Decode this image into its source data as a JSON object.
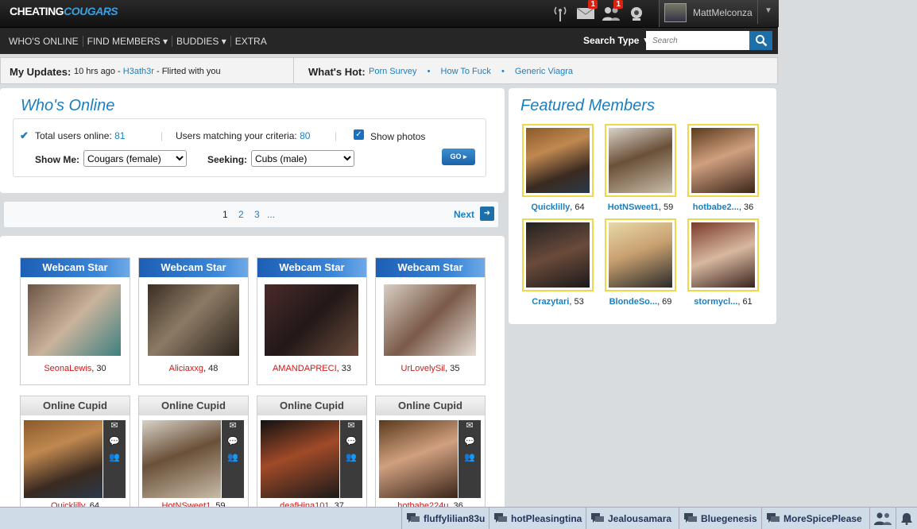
{
  "header": {
    "logo_part1": "CHEATING",
    "logo_part2": "COUGARS",
    "mail_badge": "1",
    "buddies_badge": "1",
    "username": "MattMelconza"
  },
  "nav": {
    "items": [
      "WHO'S ONLINE",
      "FIND MEMBERS ▾",
      "BUDDIES ▾",
      "EXTRA"
    ],
    "search_type": "Search Type ▼",
    "search_placeholder": "Search"
  },
  "updates": {
    "label": "My Updates:",
    "time": "10 hrs ago -",
    "user": "H3ath3r",
    "action": "- Flirted with you",
    "hot_label": "What's Hot:",
    "hot_links": [
      "Porn Survey",
      "How To Fuck",
      "Generic Viagra"
    ]
  },
  "whos_online": {
    "title": "Who's Online",
    "total_label": "Total users online:",
    "total_value": "81",
    "matching_label": "Users matching your criteria:",
    "matching_value": "80",
    "show_photos": "Show photos",
    "show_me_label": "Show Me:",
    "show_me_value": "Cougars (female)",
    "seeking_label": "Seeking:",
    "seeking_value": "Cubs (male)",
    "go": "GO ▸"
  },
  "pager": {
    "pages": [
      "1",
      "2",
      "3",
      "..."
    ],
    "next": "Next"
  },
  "webcam_header": "Webcam Star",
  "cupid_header": "Online Cupid",
  "webcam_cards": [
    {
      "name": "SeonaLewis",
      "age": ", 30"
    },
    {
      "name": "Aliciaxxg",
      "age": ", 48"
    },
    {
      "name": "AMANDAPRECI",
      "age": ", 33"
    },
    {
      "name": "UrLovelySil",
      "age": ", 35"
    }
  ],
  "cupid_cards": [
    {
      "name": "Quicklilly",
      "age": ", 64"
    },
    {
      "name": "HotNSweet1",
      "age": ", 59"
    },
    {
      "name": "deafHina101",
      "age": ", 37"
    },
    {
      "name": "hotbabe224u",
      "age": ", 36"
    }
  ],
  "featured": {
    "title": "Featured Members",
    "members": [
      {
        "name": "Quicklilly",
        "age": ", 64"
      },
      {
        "name": "HotNSweet1",
        "age": ", 59"
      },
      {
        "name": "hotbabe2...",
        "age": ", 36"
      },
      {
        "name": "Crazytari",
        "age": ", 53"
      },
      {
        "name": "BlondeSo...",
        "age": ", 69"
      },
      {
        "name": "stormycl...",
        "age": ", 61"
      }
    ]
  },
  "chatbar": [
    "fluffylilian83u",
    "hotPleasingtina",
    "Jealousamara",
    "Bluegenesis",
    "MoreSpicePlease"
  ]
}
